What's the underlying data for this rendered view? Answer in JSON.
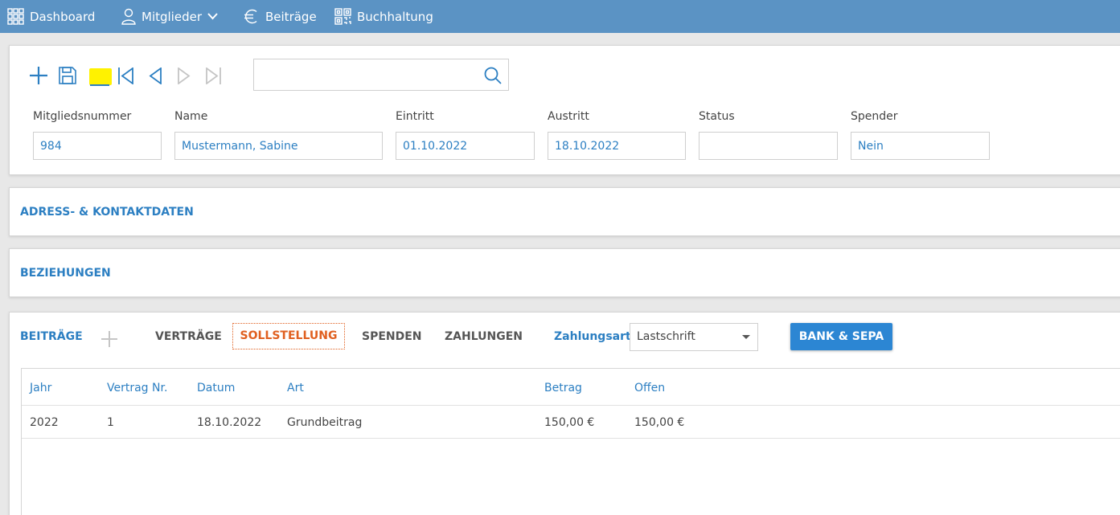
{
  "nav": {
    "dashboard": "Dashboard",
    "mitglieder": "Mitglieder",
    "beitraege": "Beiträge",
    "buchhaltung": "Buchhaltung"
  },
  "toolbar": {
    "search_value": "",
    "icons": [
      "add-icon",
      "save-icon",
      "remove-icon",
      "first-record-icon",
      "previous-record-icon",
      "next-record-icon",
      "last-record-icon",
      "search-icon"
    ]
  },
  "fields": {
    "mitgliedsnummer": {
      "label": "Mitgliedsnummer",
      "value": "984"
    },
    "name": {
      "label": "Name",
      "value": "Mustermann, Sabine"
    },
    "eintritt": {
      "label": "Eintritt",
      "value": "01.10.2022"
    },
    "austritt": {
      "label": "Austritt",
      "value": "18.10.2022"
    },
    "status": {
      "label": "Status",
      "value": ""
    },
    "spender": {
      "label": "Spender",
      "value": "Nein"
    }
  },
  "sections": {
    "adress": "ADRESS- & KONTAKTDATEN",
    "beziehungen": "BEZIEHUNGEN"
  },
  "beitraege": {
    "title": "BEITRÄGE",
    "tabs": {
      "vertraege": "VERTRÄGE",
      "sollstellung": "SOLLSTELLUNG",
      "spenden": "SPENDEN",
      "zahlungen": "ZAHLUNGEN"
    },
    "zahlungsart_label": "Zahlungsart",
    "zahlungsart_value": "Lastschrift",
    "bank_button": "BANK & SEPA",
    "table": {
      "columns": [
        "Jahr",
        "Vertrag Nr.",
        "Datum",
        "Art",
        "Betrag",
        "Offen"
      ],
      "rows": [
        [
          "2022",
          "1",
          "18.10.2022",
          "Grundbeitrag",
          "150,00 €",
          "150,00 €"
        ]
      ]
    }
  },
  "colors": {
    "nav_bg": "#5b93c4",
    "accent": "#2c7fc2",
    "active_tab": "#e06020",
    "highlight": "#fff200"
  }
}
